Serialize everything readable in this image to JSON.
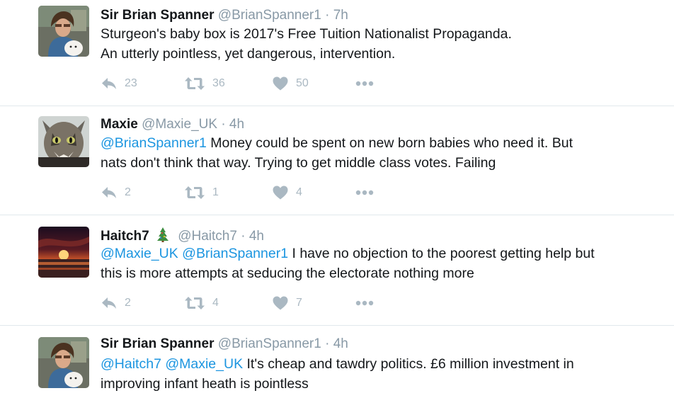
{
  "tweets": [
    {
      "name": "Sir Brian Spanner",
      "handle": "@BrianSpanner1",
      "dot": "·",
      "time": "7h",
      "line1": "Sturgeon's baby box is 2017's Free Tuition Nationalist Propaganda.",
      "line2": "An utterly pointless, yet dangerous, intervention.",
      "replies": "23",
      "retweets": "36",
      "likes": "50"
    },
    {
      "name": "Maxie",
      "handle": "@Maxie_UK",
      "dot": "·",
      "time": "4h",
      "mention1": "@BrianSpanner1",
      "line1_rest": " Money could be spent on new born babies who need it. But",
      "line2": "nats don't think that way. Trying to get middle class votes. Failing",
      "replies": "2",
      "retweets": "1",
      "likes": "4"
    },
    {
      "name": "Haitch7",
      "emoji": "christmas-tree",
      "handle": "@Haitch7",
      "dot": "·",
      "time": "4h",
      "mention1": "@Maxie_UK",
      "mention2": "@BrianSpanner1",
      "line1_rest": " I have no objection to the poorest getting help but",
      "line2": "this is more attempts at seducing the electorate nothing more",
      "replies": "2",
      "retweets": "4",
      "likes": "7"
    },
    {
      "name": "Sir Brian Spanner",
      "handle": "@BrianSpanner1",
      "dot": "·",
      "time": "4h",
      "mention1": "@Haitch7",
      "mention2": "@Maxie_UK",
      "line1_rest": " It's cheap and tawdry politics. £6 million investment in",
      "line2": "improving infant heath is pointless"
    }
  ],
  "colors": {
    "link": "#1b95e0",
    "muted": "#8899a6",
    "icon": "#aab8c2",
    "divider": "#e1e8ed"
  },
  "icons": [
    "reply-icon",
    "retweet-icon",
    "like-icon",
    "more-icon"
  ]
}
